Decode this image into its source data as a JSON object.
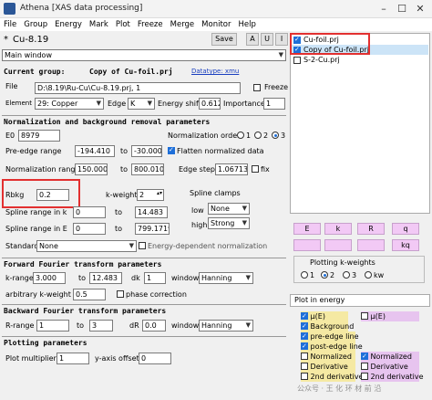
{
  "window": {
    "title": "Athena [XAS data processing]"
  },
  "menu": [
    "File",
    "Group",
    "Energy",
    "Mark",
    "Plot",
    "Freeze",
    "Merge",
    "Monitor",
    "Help"
  ],
  "project": {
    "name": "Cu-8.19",
    "modified_marker": "*",
    "save_label": "Save",
    "btn_a": "A",
    "btn_u": "U",
    "btn_i": "I"
  },
  "view_select": "Main window",
  "current_group": {
    "label": "Current group:",
    "name": "Copy of Cu-foil.prj",
    "datatype": "Datatype: xmu"
  },
  "file": {
    "label": "File",
    "value": "D:\\8.19\\Ru-Cu\\Cu-8.19.prj, 1",
    "freeze_label": "Freeze"
  },
  "element": {
    "label": "Element",
    "value": "29: Copper",
    "edge_label": "Edge",
    "edge_value": "K",
    "shift_label": "Energy shift",
    "shift_value": "0.612",
    "importance_label": "Importance",
    "importance_value": "1"
  },
  "norm": {
    "header": "Normalization and background removal parameters",
    "e0_label": "E0",
    "e0_value": "8979",
    "order_label": "Normalization order",
    "order_options": [
      "1",
      "2",
      "3"
    ],
    "preedge_label": "Pre-edge range",
    "preedge_from": "-194.410",
    "to_label": "to",
    "preedge_to": "-30.000",
    "flatten_label": "Flatten normalized data",
    "normrange_label": "Normalization range",
    "normrange_from": "150.000",
    "normrange_to": "800.010",
    "edgestep_label": "Edge step",
    "edgestep_value": "1.067132",
    "fix_label": "fix",
    "rbkg_label": "Rbkg",
    "rbkg_value": "0.2",
    "kweight_label": "k-weight",
    "kweight_value": "2",
    "clamps_label": "Spline clamps",
    "low_label": "low",
    "low_value": "None",
    "high_label": "high",
    "high_value": "Strong",
    "splinek_label": "Spline range in k",
    "splinek_from": "0",
    "splinek_to": "14.483",
    "splinee_label": "Spline range in E",
    "splinee_from": "0",
    "splinee_to": "799.1719",
    "standard_label": "Standard",
    "standard_value": "None",
    "energy_dep_label": "Energy-dependent normalization"
  },
  "fft": {
    "header": "Forward Fourier transform parameters",
    "krange_label": "k-range",
    "krange_from": "3.000",
    "to_label": "to",
    "krange_to": "12.483",
    "dk_label": "dk",
    "dk_value": "1",
    "window_label": "window",
    "window_value": "Hanning",
    "arbk_label": "arbitrary k-weight",
    "arbk_value": "0.5",
    "phase_label": "phase correction"
  },
  "bft": {
    "header": "Backward Fourier transform parameters",
    "rrange_label": "R-range",
    "rrange_from": "1",
    "to_label": "to",
    "rrange_to": "3",
    "dr_label": "dR",
    "dr_value": "0.0",
    "window_label": "window",
    "window_value": "Hanning"
  },
  "plotting": {
    "header": "Plotting parameters",
    "mult_label": "Plot multiplier",
    "mult_value": "1",
    "yoffset_label": "y-axis offset",
    "yoffset_value": "0"
  },
  "groups": [
    {
      "name": "Cu-foil.prj",
      "checked": true,
      "selected": false
    },
    {
      "name": "Copy of Cu-foil.prj",
      "checked": true,
      "selected": true
    },
    {
      "name": "S-2-Cu.prj",
      "checked": false,
      "selected": false
    }
  ],
  "plot_buttons_row1": [
    "E",
    "k",
    "R",
    "q"
  ],
  "plot_buttons_row2": [
    "kq"
  ],
  "kweights": {
    "title": "Plotting k-weights",
    "options": [
      "1",
      "2",
      "3",
      "kw"
    ]
  },
  "plot_in_energy": "Plot in energy",
  "energy_options": {
    "mu": "μ(E)",
    "background": "Background",
    "preedge": "pre-edge line",
    "postedge": "post-edge line",
    "normalized": "Normalized",
    "derivative": "Derivative",
    "second_derivative": "2nd derivative"
  },
  "right_options": {
    "mu": "μ(E)",
    "normalized": "Normalized",
    "derivative": "Derivative",
    "second_derivative": "2nd derivative"
  },
  "watermark": "公众号 · 王 化 环 材 前 沿",
  "colors": {
    "accent": "#1e6fd9",
    "plot_button": "#f2c9f5",
    "highlight": "#e23030",
    "selection": "#cce4f7"
  }
}
